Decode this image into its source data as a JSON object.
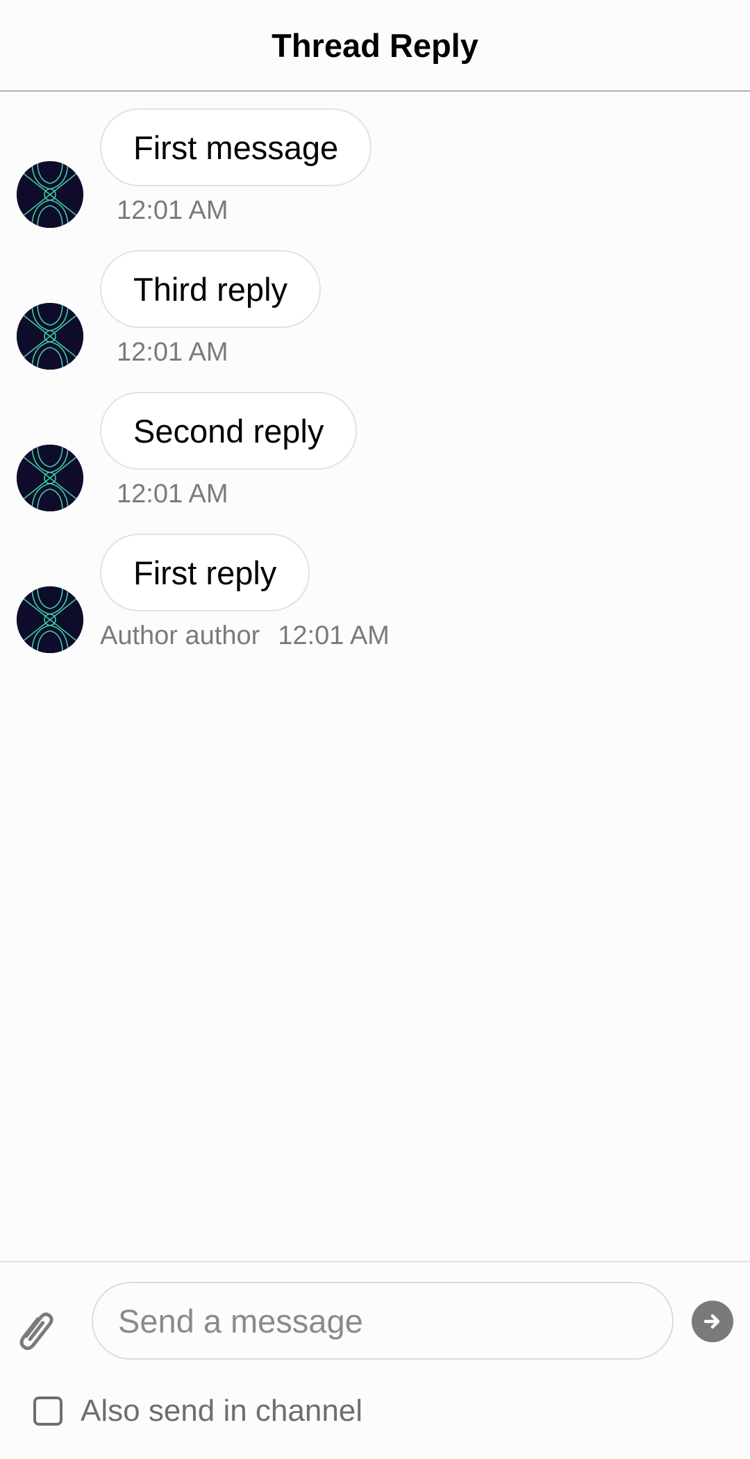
{
  "header": {
    "title": "Thread Reply"
  },
  "messages": [
    {
      "text": "First message",
      "author": "",
      "time": "12:01 AM"
    },
    {
      "text": "Third reply",
      "author": "",
      "time": "12:01 AM"
    },
    {
      "text": "Second reply",
      "author": "",
      "time": "12:01 AM"
    },
    {
      "text": "First reply",
      "author": "Author author",
      "time": "12:01 AM"
    }
  ],
  "composer": {
    "placeholder": "Send a message",
    "attach_icon": "paperclip-icon",
    "send_icon": "arrow-right-icon",
    "also_send_label": "Also send in channel",
    "also_send_checked": false
  },
  "colors": {
    "avatar_bg": "#0e0b2b",
    "avatar_lines": "#3fd0a0",
    "send_button": "#7a7a7a"
  }
}
